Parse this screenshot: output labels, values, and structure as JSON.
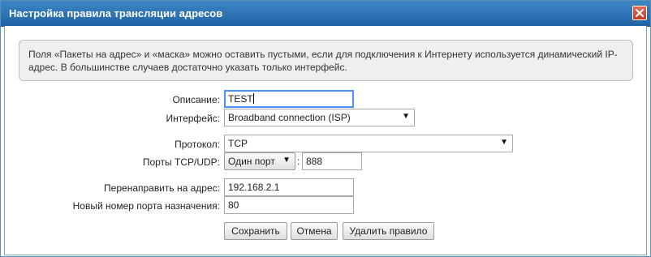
{
  "dialog": {
    "title": "Настройка правила трансляции адресов",
    "close_icon": "close-icon",
    "notice": "Поля «Пакеты на адрес» и «маска» можно оставить пустыми, если для подключения к Интернету используется динамический IP-адрес. В большинстве случаев достаточно указать только интерфейс."
  },
  "form": {
    "description_label": "Описание:",
    "description_value": "TEST",
    "interface_label": "Интерфейс:",
    "interface_value": "Broadband connection (ISP)",
    "protocol_label": "Протокол:",
    "protocol_value": "TCP",
    "ports_label": "Порты TCP/UDP:",
    "port_mode_value": "Один порт",
    "port_separator": ":",
    "port_value": "888",
    "redirect_label": "Перенаправить на адрес:",
    "redirect_value": "192.168.2.1",
    "dest_port_label": "Новый номер порта назначения:",
    "dest_port_value": "80"
  },
  "buttons": {
    "save": "Сохранить",
    "cancel": "Отмена",
    "delete": "Удалить правило"
  },
  "colors": {
    "titlebar": "#2f74b6",
    "close_button": "#d5503b",
    "focus_border": "#4d90fe"
  }
}
